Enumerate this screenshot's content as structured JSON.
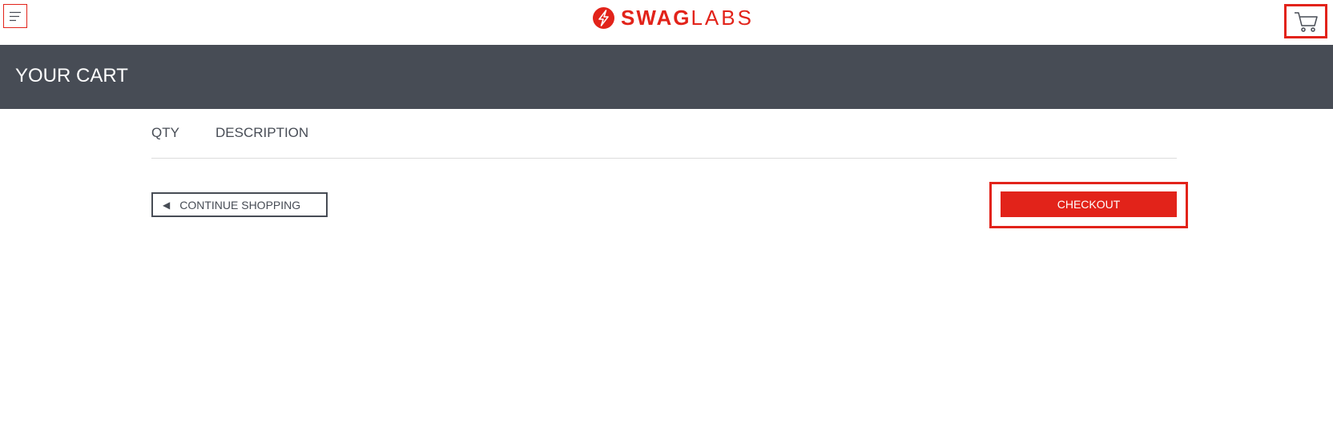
{
  "header": {
    "menu_icon": "hamburger-menu-icon",
    "logo": {
      "text_bold": "SWAG",
      "text_light": "LABS",
      "mark_icon": "swag-labs-bolt-icon"
    },
    "cart_icon": "shopping-cart-icon"
  },
  "title_bar": {
    "title": "YOUR CART"
  },
  "cart_list": {
    "columns": {
      "qty": "QTY",
      "description": "DESCRIPTION"
    },
    "items": []
  },
  "actions": {
    "continue_shopping": {
      "arrow": "◀",
      "label": "CONTINUE SHOPPING"
    },
    "checkout": {
      "label": "CHECKOUT"
    }
  },
  "colors": {
    "brand_red": "#e2231a",
    "title_bar_bg": "#474c55",
    "text_dark": "#474c55",
    "divider": "#dcdcdc"
  }
}
